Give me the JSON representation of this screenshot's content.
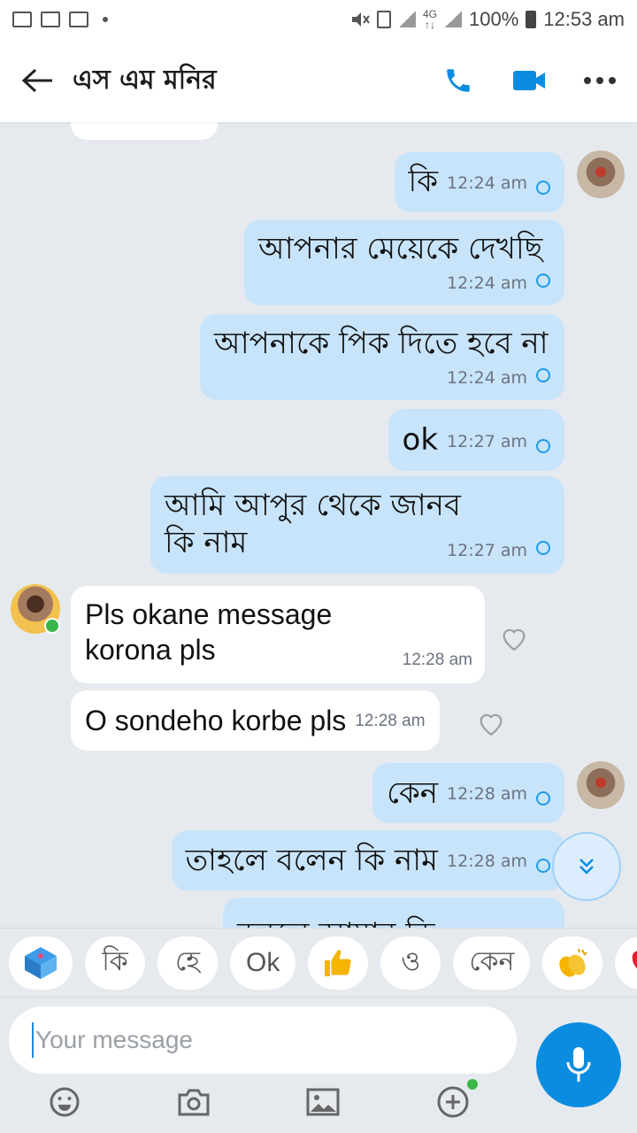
{
  "status_bar": {
    "net_top": "4G",
    "net_bottom": "↑↓",
    "battery": "100%",
    "time": "12:53 am"
  },
  "header": {
    "contact_name": "এস এম মনির"
  },
  "colors": {
    "accent": "#0a8de0",
    "outgoing_bubble": "#c8e4fb",
    "incoming_bubble": "#ffffff",
    "background": "#e6eaee"
  },
  "messages": [
    {
      "direction": "out",
      "text": "কি",
      "time": "12:24 am"
    },
    {
      "direction": "out",
      "text": "আপনার মেয়েকে দেখছি",
      "time": "12:24 am"
    },
    {
      "direction": "out",
      "text": "আপনাকে পিক দিতে হবে না",
      "time": "12:24 am"
    },
    {
      "direction": "out",
      "text": "ok",
      "time": "12:27 am"
    },
    {
      "direction": "out",
      "text": "আমি আপুর থেকে জানব কি নাম",
      "time": "12:27 am"
    },
    {
      "direction": "in",
      "text": "Pls okane message korona pls",
      "time": "12:28 am"
    },
    {
      "direction": "in",
      "text": "O sondeho korbe pls",
      "time": "12:28 am"
    },
    {
      "direction": "out",
      "text": "কেন",
      "time": "12:28 am"
    },
    {
      "direction": "out",
      "text": "তাহলে বলেন কি নাম",
      "time": "12:28 am"
    },
    {
      "direction": "out",
      "text": "করলে আমার কি",
      "time": ""
    }
  ],
  "quick_replies": [
    "কি",
    "হে",
    "Ok",
    "ও",
    "কেন"
  ],
  "quick_reply_icons": [
    "sticker-icon",
    "thumbs-up-icon",
    "clapping-icon",
    "heart-icon"
  ],
  "composer": {
    "placeholder": "Your message"
  }
}
